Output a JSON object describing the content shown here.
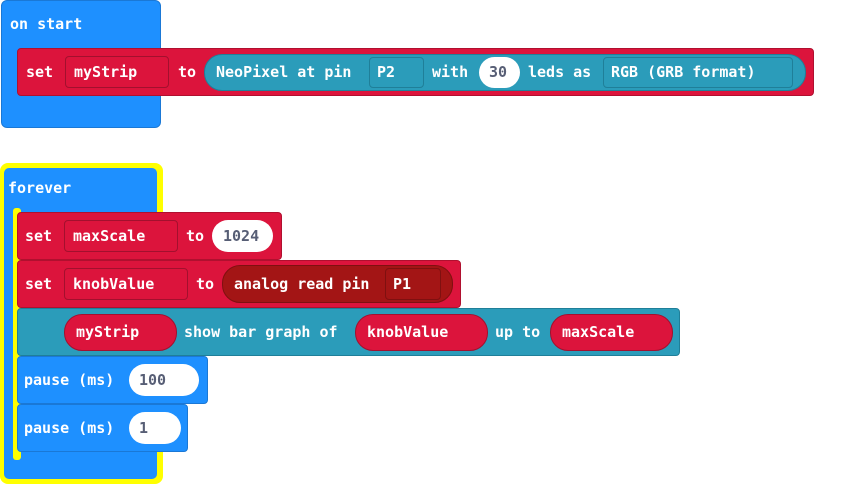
{
  "on_start": {
    "hat_label": "on start",
    "set_label": "set",
    "variable": "myStrip",
    "to_label": "to",
    "neopixel_label": "NeoPixel at pin",
    "pin": "P2",
    "with_label": "with",
    "leds_count": "30",
    "leds_as_label": "leds as",
    "format": "RGB (GRB format)"
  },
  "forever": {
    "hat_label": "forever",
    "set1": {
      "set_label": "set",
      "variable": "maxScale",
      "to_label": "to",
      "value": "1024"
    },
    "set2": {
      "set_label": "set",
      "variable": "knobValue",
      "to_label": "to",
      "reporter_label": "analog read pin",
      "pin": "P1"
    },
    "bar_graph": {
      "strip": "myStrip",
      "show_label": "show bar graph of",
      "value_var": "knobValue",
      "up_to_label": "up to",
      "max_var": "maxScale"
    },
    "pause1": {
      "label": "pause (ms)",
      "value": "100"
    },
    "pause2": {
      "label": "pause (ms)",
      "value": "1"
    }
  },
  "colors": {
    "basic_blue": "#1e90ff",
    "variables_red": "#dc143c",
    "neopixel_teal": "#2b9cba",
    "pins_darkred": "#a31515",
    "highlight_yellow": "#ffff00"
  }
}
